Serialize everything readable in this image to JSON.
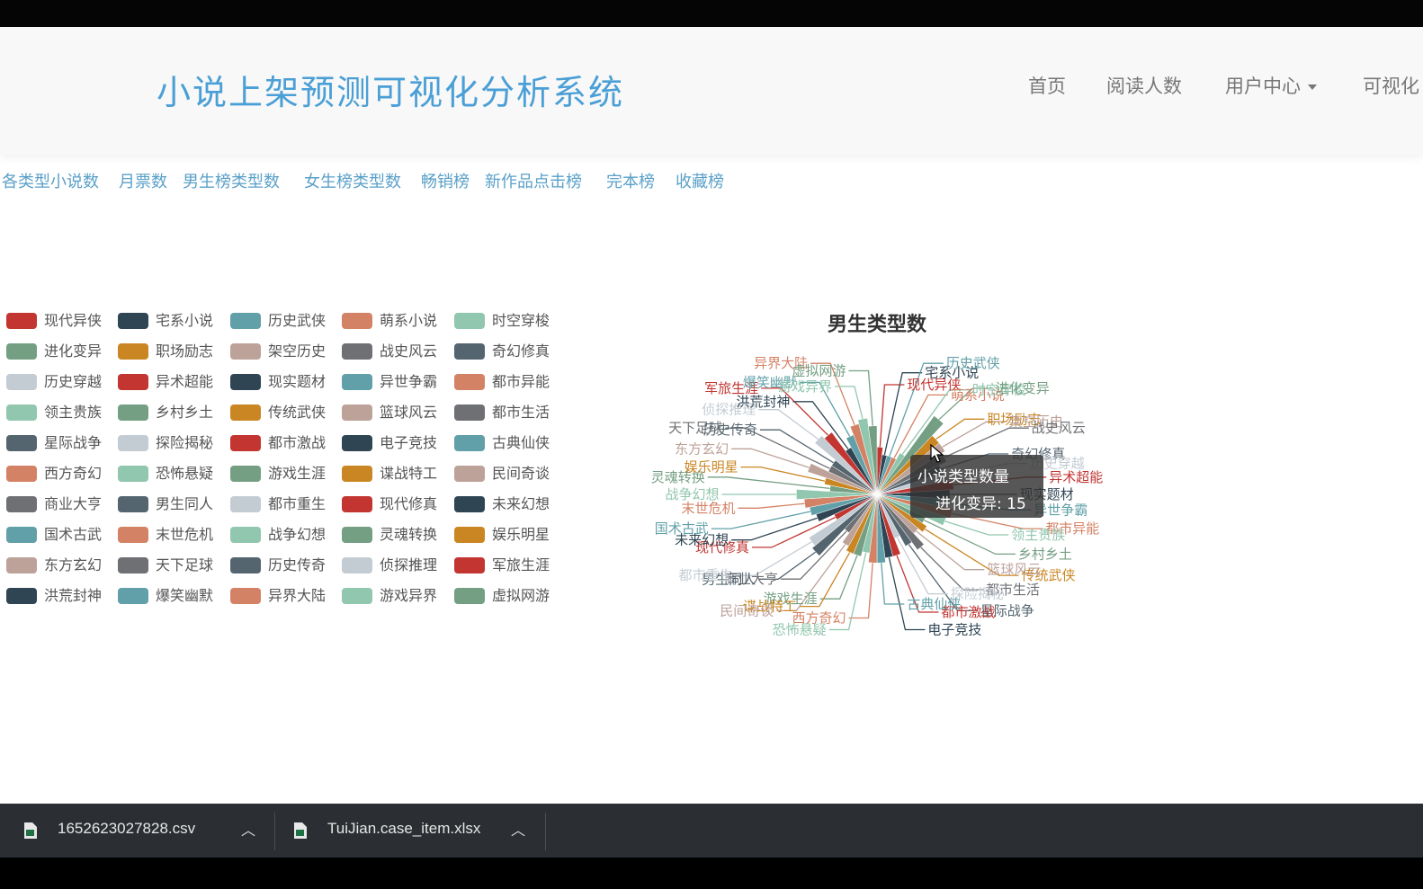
{
  "navbar": {
    "brand": "小说上架预测可视化分析系统",
    "links": [
      {
        "label": "首页"
      },
      {
        "label": "阅读人数"
      },
      {
        "label": "用户中心"
      },
      {
        "label": "可视化"
      }
    ]
  },
  "tabs": [
    "各类型小说数",
    "月票数",
    "男生榜类型数",
    "女生榜类型数",
    "畅销榜",
    "新作品点击榜",
    "完本榜",
    "收藏榜"
  ],
  "chart_data": {
    "type": "pie",
    "variant": "rose",
    "title": "男生类型数",
    "series_name": "小说类型数量",
    "palette": [
      "#c23531",
      "#2f4554",
      "#61a0a8",
      "#d48265",
      "#91c7ae",
      "#749f83",
      "#ca8622",
      "#bda29a",
      "#6e7074",
      "#546570",
      "#c4ccd3"
    ],
    "categories": [
      "现代异侠",
      "宅系小说",
      "历史武侠",
      "萌系小说",
      "时空穿梭",
      "进化变异",
      "职场励志",
      "架空历史",
      "战史风云",
      "奇幻修真",
      "历史穿越",
      "异术超能",
      "现实题材",
      "异世争霸",
      "都市异能",
      "领主贵族",
      "乡村乡土",
      "传统武侠",
      "篮球风云",
      "都市生活",
      "星际战争",
      "探险揭秘",
      "都市激战",
      "电子竞技",
      "古典仙侠",
      "西方奇幻",
      "恐怖悬疑",
      "游戏生涯",
      "谍战特工",
      "民间奇谈",
      "商业大亨",
      "男生同人",
      "都市重生",
      "现代修真",
      "未来幻想",
      "国术古武",
      "末世危机",
      "战争幻想",
      "灵魂转换",
      "娱乐明星",
      "东方玄幻",
      "天下足球",
      "历史传奇",
      "侦探推理",
      "军旅生涯",
      "洪荒封神",
      "爆笑幽默",
      "异界大陆",
      "游戏异界",
      "虚拟网游"
    ],
    "values": [
      3,
      2,
      2,
      2,
      3,
      15,
      10,
      10,
      9,
      7,
      8,
      9,
      8,
      6,
      9,
      8,
      4,
      5,
      4,
      7,
      5,
      3,
      6,
      6,
      7,
      7,
      5,
      6,
      6,
      5,
      3,
      11,
      10,
      3,
      6,
      7,
      8,
      10,
      3,
      4,
      8,
      4,
      4,
      10,
      9,
      4,
      6,
      8,
      9,
      7
    ],
    "legend": "left"
  },
  "tooltip": {
    "title": "小说类型数量",
    "row": "进化变异: 15"
  },
  "downloads": [
    {
      "name": "1652623027828.csv"
    },
    {
      "name": "TuiJian.case_item.xlsx"
    }
  ]
}
